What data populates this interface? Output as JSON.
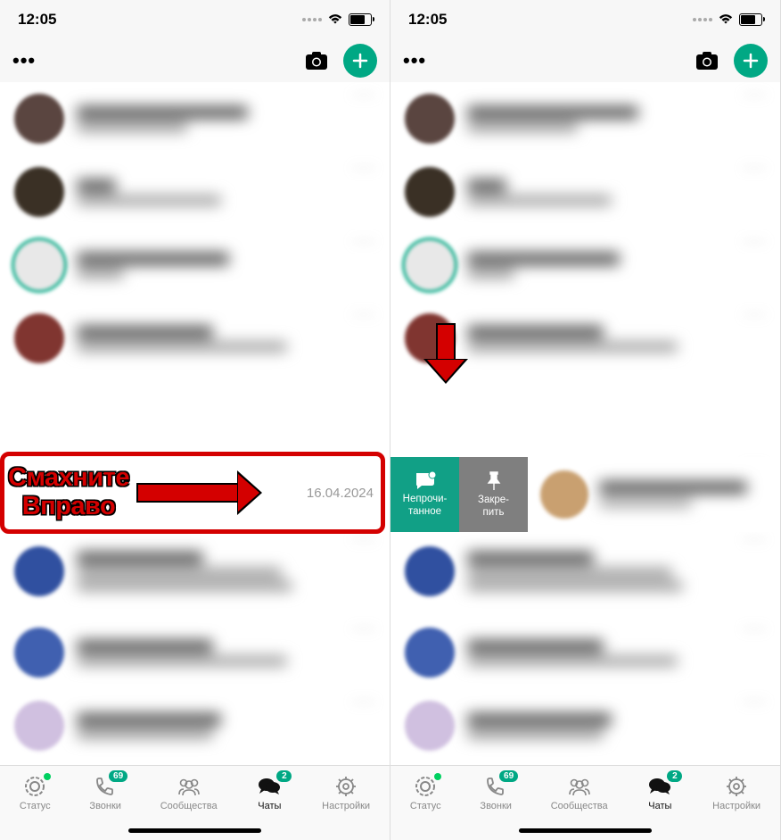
{
  "statusbar": {
    "time": "12:05"
  },
  "topbar": {
    "more": "•••"
  },
  "highlight": {
    "text_l1": "Смахните",
    "text_l2": "Вправо",
    "date": "16.04.2024"
  },
  "swipe_actions": {
    "unread_l1": "Непрочи-",
    "unread_l2": "танное",
    "pin_l1": "Закре-",
    "pin_l2": "пить"
  },
  "tabs": {
    "status": "Статус",
    "calls": "Звонки",
    "calls_badge": "69",
    "communities": "Сообщества",
    "chats": "Чаты",
    "chats_badge": "2",
    "settings": "Настройки"
  }
}
